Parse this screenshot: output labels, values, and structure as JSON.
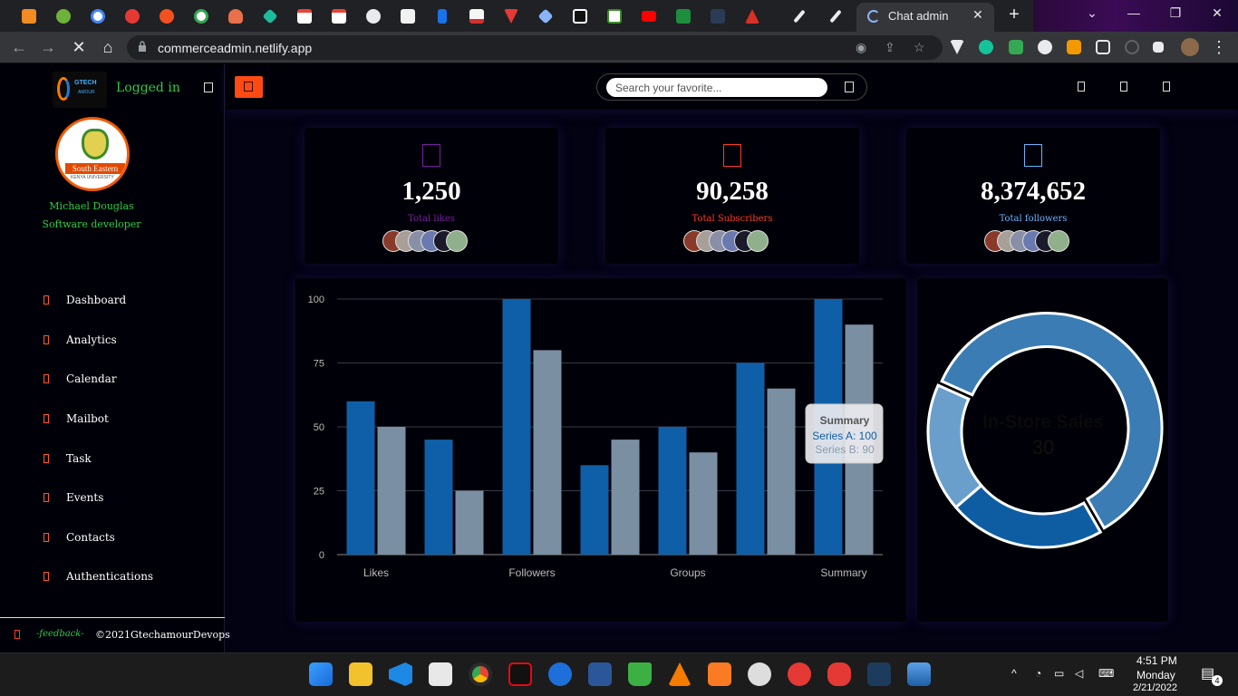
{
  "browser": {
    "active_tab_title": "Chat admin",
    "url": "commerceadmin.netlify.app",
    "new_tab_label": "+",
    "tab_close": "✕"
  },
  "sidebar": {
    "brand_text": "GTECH",
    "brand_sub": "AMOUR",
    "logged_in": "Logged in",
    "avatar_band": "South Eastern",
    "avatar_sub": "KENYA UNIVERSITY",
    "user_name": "Michael Douglas",
    "user_role": "Software developer",
    "menu": [
      {
        "label": "Dashboard"
      },
      {
        "label": "Analytics"
      },
      {
        "label": "Calendar"
      },
      {
        "label": "Mailbot"
      },
      {
        "label": "Task"
      },
      {
        "label": "Events"
      },
      {
        "label": "Contacts"
      },
      {
        "label": "Authentications"
      }
    ],
    "feedback": "-feedback-",
    "copyright": "©2021GtechamourDevops"
  },
  "topbar": {
    "search_placeholder": "Search your favorite..."
  },
  "stats": [
    {
      "value": "1,250",
      "label": "Total likes",
      "color": "#7a1fa0"
    },
    {
      "value": "90,258",
      "label": "Total Subscribers",
      "color": "#ff3b1f"
    },
    {
      "value": "8,374,652",
      "label": "Total followers",
      "color": "#6ab4ff"
    }
  ],
  "chart_data": [
    {
      "type": "bar",
      "categories": [
        "Likes",
        "",
        "Followers",
        "",
        "Groups",
        "",
        "Summary"
      ],
      "series": [
        {
          "name": "Series A",
          "values": [
            60,
            45,
            100,
            35,
            50,
            75,
            100
          ],
          "color": "#0f5fa8"
        },
        {
          "name": "Series B",
          "values": [
            50,
            25,
            80,
            45,
            40,
            65,
            90
          ],
          "color": "#7b8fa3"
        }
      ],
      "ylim": [
        0,
        100
      ],
      "yticks": [
        0,
        25,
        50,
        75,
        100
      ],
      "tooltip": {
        "title": "Summary",
        "lines": [
          "Series A: 100",
          "Series B: 90"
        ]
      },
      "grid": true
    },
    {
      "type": "pie",
      "values": [
        60,
        22,
        18
      ],
      "colors": [
        "#3a7cb3",
        "#0e5da3",
        "#6a9fcc"
      ],
      "center_title": "In-Store Sales",
      "center_value": "30"
    }
  ],
  "taskbar": {
    "time": "4:51 PM",
    "day": "Monday",
    "date": "2/21/2022",
    "notif_count": "4"
  }
}
